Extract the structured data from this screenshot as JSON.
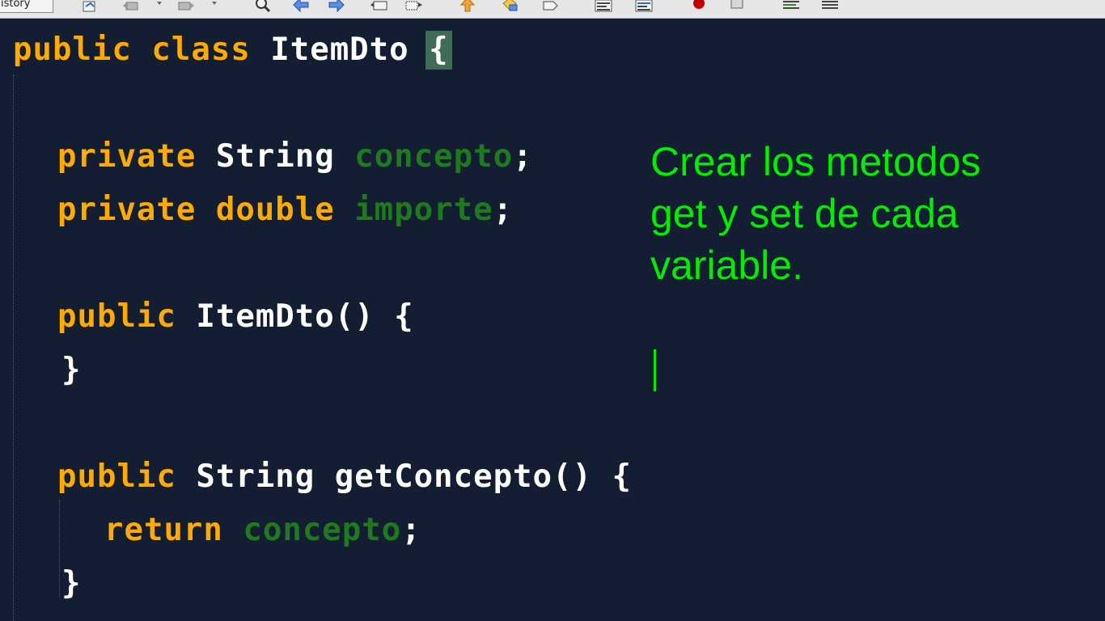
{
  "toolbar": {
    "history_tab": "istory",
    "buttons": [
      "source-history-icon",
      "back-icon",
      "forward-icon",
      "find-icon",
      "find-previous-icon",
      "find-next-icon",
      "find-selection-icon",
      "previous-bookmark-icon",
      "shift-left-icon",
      "toggle-highlight-icon",
      "toggle-bookmark-icon",
      "comment-icon",
      "uncomment-icon",
      "record-macro-icon",
      "stop-macro-icon",
      "shift-line-left-icon",
      "shift-line-right-icon"
    ],
    "record_color": "#c00000"
  },
  "editor": {
    "background": "#131e33",
    "keyword_color": "#ffaa00",
    "field_color": "#1f7a1f",
    "lines": {
      "l1": {
        "kw": "public class ",
        "name": "ItemDto ",
        "brace": "{"
      },
      "l2": {
        "kw": "private ",
        "type": "String ",
        "field": "concepto",
        "end": ";"
      },
      "l3": {
        "kw": "private double ",
        "field": "importe",
        "end": ";"
      },
      "l4": {
        "kw": "public ",
        "name": "ItemDto() {"
      },
      "l5": {
        "text": "}"
      },
      "l6": {
        "kw": "public ",
        "name": "String getConcepto() {"
      },
      "l7": {
        "kw": "return ",
        "field": "concepto",
        "end": ";"
      },
      "l8": {
        "text": "}"
      }
    }
  },
  "note": {
    "color": "#00ee00",
    "line1": "Crear los metodos",
    "line2": "get y set de cada",
    "line3": "variable."
  }
}
